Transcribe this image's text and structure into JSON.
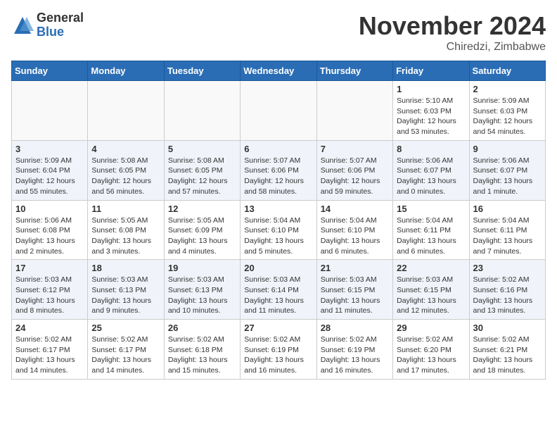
{
  "logo": {
    "general": "General",
    "blue": "Blue"
  },
  "title": "November 2024",
  "location": "Chiredzi, Zimbabwe",
  "days_header": [
    "Sunday",
    "Monday",
    "Tuesday",
    "Wednesday",
    "Thursday",
    "Friday",
    "Saturday"
  ],
  "weeks": [
    {
      "days": [
        {
          "num": "",
          "info": ""
        },
        {
          "num": "",
          "info": ""
        },
        {
          "num": "",
          "info": ""
        },
        {
          "num": "",
          "info": ""
        },
        {
          "num": "",
          "info": ""
        },
        {
          "num": "1",
          "info": "Sunrise: 5:10 AM\nSunset: 6:03 PM\nDaylight: 12 hours\nand 53 minutes."
        },
        {
          "num": "2",
          "info": "Sunrise: 5:09 AM\nSunset: 6:03 PM\nDaylight: 12 hours\nand 54 minutes."
        }
      ]
    },
    {
      "days": [
        {
          "num": "3",
          "info": "Sunrise: 5:09 AM\nSunset: 6:04 PM\nDaylight: 12 hours\nand 55 minutes."
        },
        {
          "num": "4",
          "info": "Sunrise: 5:08 AM\nSunset: 6:05 PM\nDaylight: 12 hours\nand 56 minutes."
        },
        {
          "num": "5",
          "info": "Sunrise: 5:08 AM\nSunset: 6:05 PM\nDaylight: 12 hours\nand 57 minutes."
        },
        {
          "num": "6",
          "info": "Sunrise: 5:07 AM\nSunset: 6:06 PM\nDaylight: 12 hours\nand 58 minutes."
        },
        {
          "num": "7",
          "info": "Sunrise: 5:07 AM\nSunset: 6:06 PM\nDaylight: 12 hours\nand 59 minutes."
        },
        {
          "num": "8",
          "info": "Sunrise: 5:06 AM\nSunset: 6:07 PM\nDaylight: 13 hours\nand 0 minutes."
        },
        {
          "num": "9",
          "info": "Sunrise: 5:06 AM\nSunset: 6:07 PM\nDaylight: 13 hours\nand 1 minute."
        }
      ]
    },
    {
      "days": [
        {
          "num": "10",
          "info": "Sunrise: 5:06 AM\nSunset: 6:08 PM\nDaylight: 13 hours\nand 2 minutes."
        },
        {
          "num": "11",
          "info": "Sunrise: 5:05 AM\nSunset: 6:08 PM\nDaylight: 13 hours\nand 3 minutes."
        },
        {
          "num": "12",
          "info": "Sunrise: 5:05 AM\nSunset: 6:09 PM\nDaylight: 13 hours\nand 4 minutes."
        },
        {
          "num": "13",
          "info": "Sunrise: 5:04 AM\nSunset: 6:10 PM\nDaylight: 13 hours\nand 5 minutes."
        },
        {
          "num": "14",
          "info": "Sunrise: 5:04 AM\nSunset: 6:10 PM\nDaylight: 13 hours\nand 6 minutes."
        },
        {
          "num": "15",
          "info": "Sunrise: 5:04 AM\nSunset: 6:11 PM\nDaylight: 13 hours\nand 6 minutes."
        },
        {
          "num": "16",
          "info": "Sunrise: 5:04 AM\nSunset: 6:11 PM\nDaylight: 13 hours\nand 7 minutes."
        }
      ]
    },
    {
      "days": [
        {
          "num": "17",
          "info": "Sunrise: 5:03 AM\nSunset: 6:12 PM\nDaylight: 13 hours\nand 8 minutes."
        },
        {
          "num": "18",
          "info": "Sunrise: 5:03 AM\nSunset: 6:13 PM\nDaylight: 13 hours\nand 9 minutes."
        },
        {
          "num": "19",
          "info": "Sunrise: 5:03 AM\nSunset: 6:13 PM\nDaylight: 13 hours\nand 10 minutes."
        },
        {
          "num": "20",
          "info": "Sunrise: 5:03 AM\nSunset: 6:14 PM\nDaylight: 13 hours\nand 11 minutes."
        },
        {
          "num": "21",
          "info": "Sunrise: 5:03 AM\nSunset: 6:15 PM\nDaylight: 13 hours\nand 11 minutes."
        },
        {
          "num": "22",
          "info": "Sunrise: 5:03 AM\nSunset: 6:15 PM\nDaylight: 13 hours\nand 12 minutes."
        },
        {
          "num": "23",
          "info": "Sunrise: 5:02 AM\nSunset: 6:16 PM\nDaylight: 13 hours\nand 13 minutes."
        }
      ]
    },
    {
      "days": [
        {
          "num": "24",
          "info": "Sunrise: 5:02 AM\nSunset: 6:17 PM\nDaylight: 13 hours\nand 14 minutes."
        },
        {
          "num": "25",
          "info": "Sunrise: 5:02 AM\nSunset: 6:17 PM\nDaylight: 13 hours\nand 14 minutes."
        },
        {
          "num": "26",
          "info": "Sunrise: 5:02 AM\nSunset: 6:18 PM\nDaylight: 13 hours\nand 15 minutes."
        },
        {
          "num": "27",
          "info": "Sunrise: 5:02 AM\nSunset: 6:19 PM\nDaylight: 13 hours\nand 16 minutes."
        },
        {
          "num": "28",
          "info": "Sunrise: 5:02 AM\nSunset: 6:19 PM\nDaylight: 13 hours\nand 16 minutes."
        },
        {
          "num": "29",
          "info": "Sunrise: 5:02 AM\nSunset: 6:20 PM\nDaylight: 13 hours\nand 17 minutes."
        },
        {
          "num": "30",
          "info": "Sunrise: 5:02 AM\nSunset: 6:21 PM\nDaylight: 13 hours\nand 18 minutes."
        }
      ]
    }
  ]
}
